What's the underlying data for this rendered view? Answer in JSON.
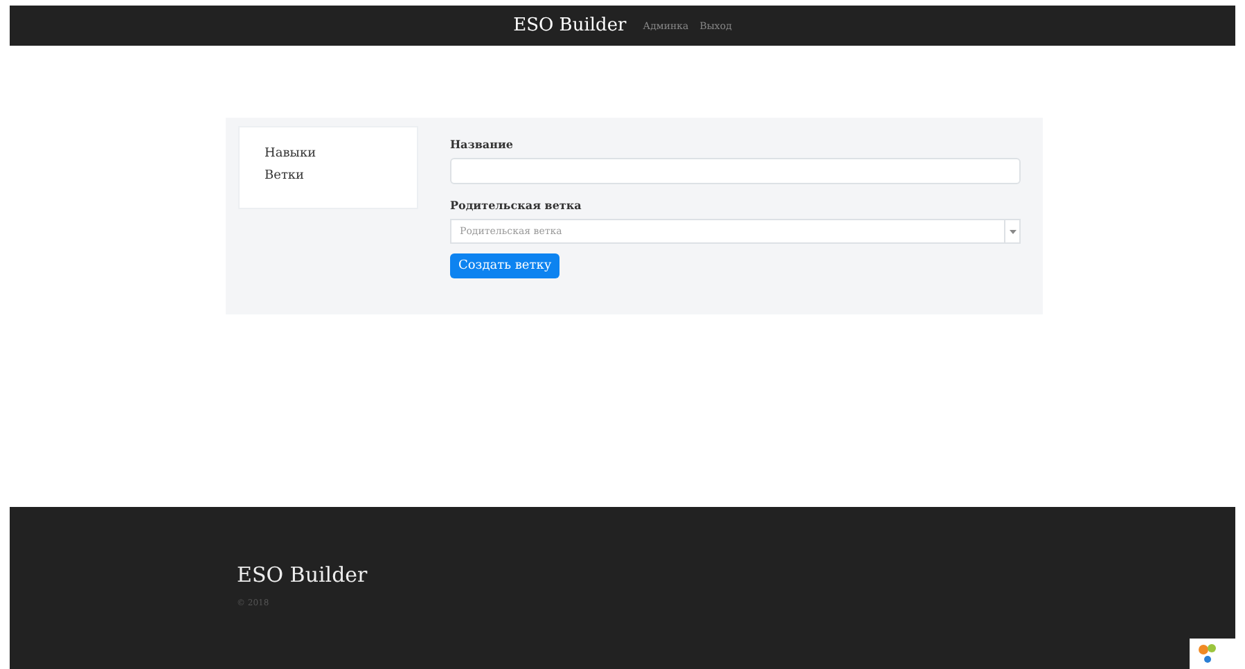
{
  "navbar": {
    "brand": "ESO Builder",
    "links": [
      "Админка",
      "Выход"
    ]
  },
  "sidebar": {
    "items": [
      "Навыки",
      "Ветки"
    ]
  },
  "form": {
    "fields": [
      {
        "kind": "text",
        "label": "Название"
      },
      {
        "kind": "select",
        "label": "Родительская ветка",
        "placeholder": "Родительская ветка"
      }
    ],
    "submit": "Создать ветку"
  },
  "footer": {
    "brand": "ESO Builder",
    "copyright": "© 2018"
  }
}
